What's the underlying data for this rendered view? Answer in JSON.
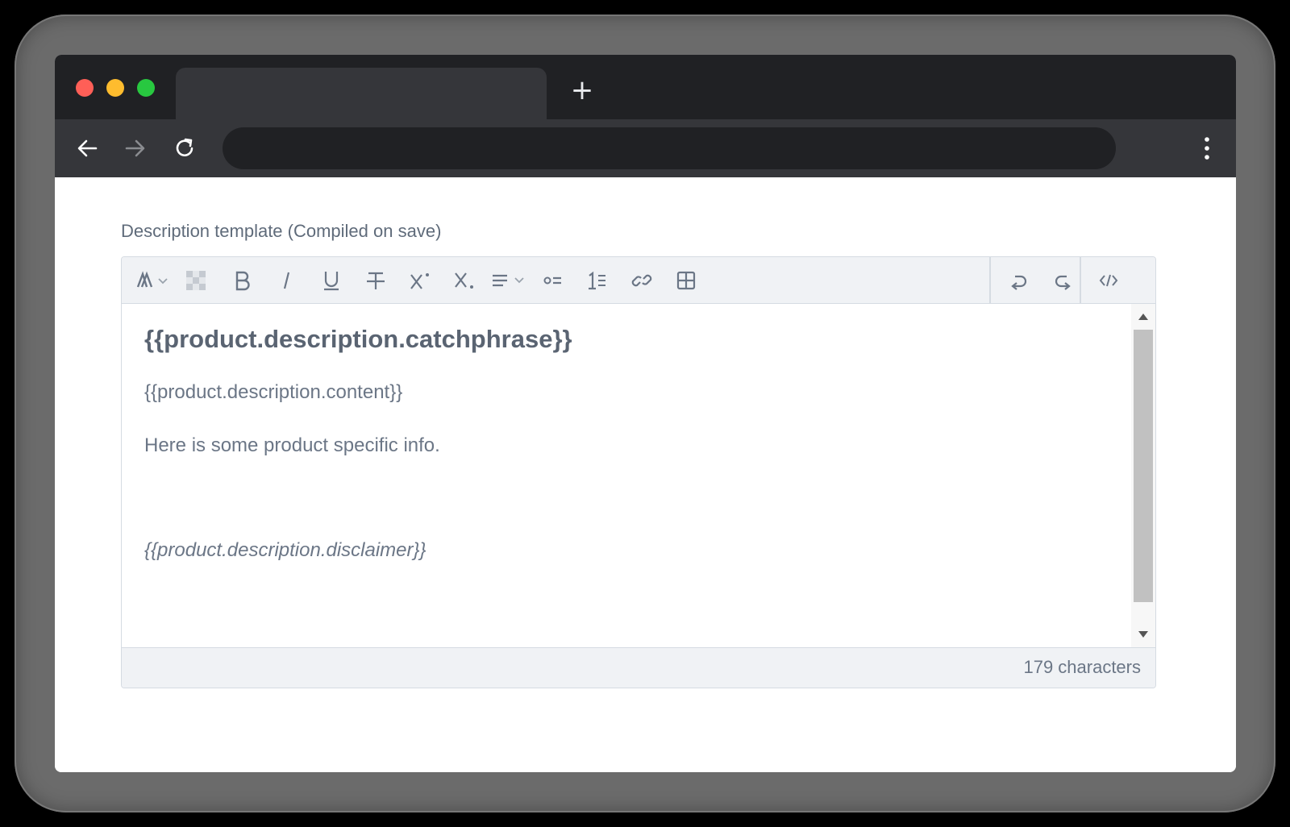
{
  "browser": {
    "new_tab_label": "+",
    "back_icon": "arrow-left-icon",
    "forward_icon": "arrow-right-icon",
    "reload_icon": "reload-icon",
    "menu_icon": "kebab-menu-icon"
  },
  "form": {
    "label": "Description template (Compiled on save)"
  },
  "editor": {
    "toolbar": [
      {
        "name": "font-style-dropdown",
        "icon": "font-icon"
      },
      {
        "name": "clear-format-button",
        "icon": "checker-icon"
      },
      {
        "name": "bold-button",
        "icon": "bold-icon"
      },
      {
        "name": "italic-button",
        "icon": "italic-icon"
      },
      {
        "name": "underline-button",
        "icon": "underline-icon"
      },
      {
        "name": "strikethrough-button",
        "icon": "strikethrough-icon"
      },
      {
        "name": "superscript-button",
        "icon": "superscript-icon"
      },
      {
        "name": "subscript-button",
        "icon": "subscript-icon"
      },
      {
        "name": "align-dropdown",
        "icon": "align-icon"
      },
      {
        "name": "bullet-list-button",
        "icon": "bullet-list-icon"
      },
      {
        "name": "numbered-list-button",
        "icon": "numbered-list-icon"
      },
      {
        "name": "link-button",
        "icon": "link-icon"
      },
      {
        "name": "table-button",
        "icon": "table-icon"
      },
      {
        "name": "undo-button",
        "icon": "undo-icon"
      },
      {
        "name": "redo-button",
        "icon": "redo-icon"
      },
      {
        "name": "source-code-button",
        "icon": "code-icon"
      }
    ],
    "content": {
      "heading": "{{product.description.catchphrase}}",
      "paragraph1": "{{product.description.content}}",
      "paragraph2": "Here is some product specific info.",
      "paragraph3": "{{product.description.disclaimer}}"
    },
    "status": {
      "char_count": "179 characters"
    }
  },
  "colors": {
    "tab_strip": "#202124",
    "toolbar": "#35363a",
    "editor_chrome": "#f0f2f5"
  }
}
